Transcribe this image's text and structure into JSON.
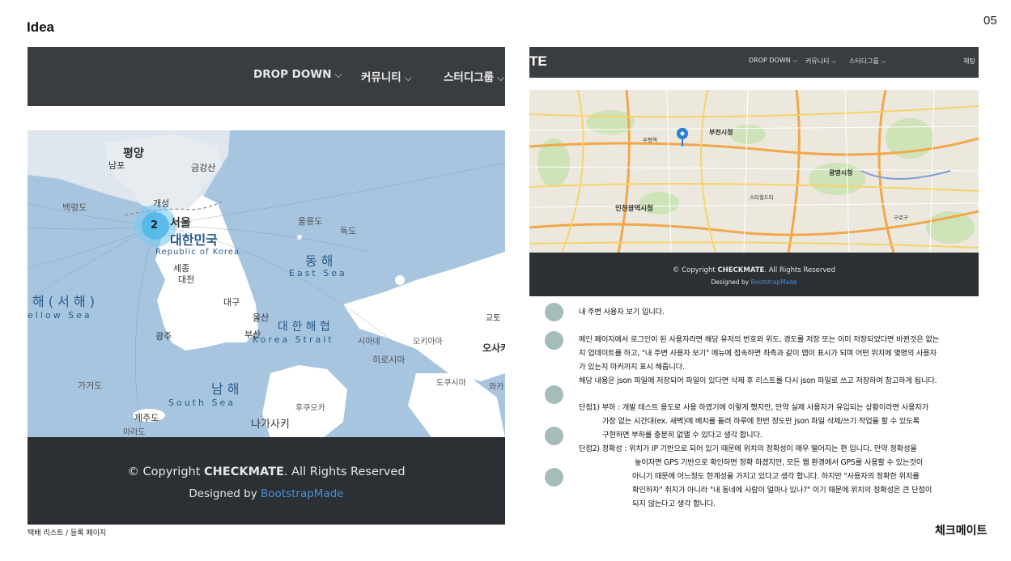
{
  "header": {
    "title": "Idea",
    "page_number": "05"
  },
  "left_mockup": {
    "nav": [
      {
        "label": "DROP DOWN",
        "icon": "chevron-down-icon"
      },
      {
        "label": "커뮤니티",
        "icon": "chevron-down-icon"
      },
      {
        "label": "스터디그룹",
        "icon": "chevron-down-icon"
      }
    ],
    "map": {
      "cluster_count": "2",
      "labels": {
        "pyongyang": "평양",
        "nampo": "남포",
        "geumgangsan": "금강산",
        "baengnyeongdo": "백령도",
        "kaesong": "개성",
        "seoul": "서울",
        "korea_ko": "대한민국",
        "korea_en": "Republic of Korea",
        "ulleungdo": "울릉도",
        "dokdo": "독도",
        "east_sea_ko": "동 해",
        "east_sea_en": "East Sea",
        "sejong": "세종",
        "daejeon": "대전",
        "yellow_sea_ko": "해 ( 서 해 )",
        "yellow_sea_en": "ellow Sea",
        "daegu": "대구",
        "ulsan": "울산",
        "korea_strait_ko": "대 한 해 협",
        "korea_strait_en": "Korea Strait",
        "gwangju": "광주",
        "busan": "부산",
        "shimane": "시마네",
        "okinoshima": "오키아마",
        "hiroshima": "히로시마",
        "osaka": "오사카",
        "kyoto": "교토",
        "gageodo": "가거도",
        "south_sea_ko": "남 해",
        "south_sea_en": "South Sea",
        "tokushima": "도쿠시마",
        "wakayama": "와카",
        "fukuoka": "후쿠오카",
        "jejudo": "제주도",
        "marado": "마라도",
        "nagasaki": "나가사키"
      }
    },
    "footer": {
      "copyright_prefix": "© Copyright ",
      "brand": "CHECKMATE",
      "copyright_suffix": ". All Rights Reserved",
      "designed_prefix": "Designed by ",
      "designed_link": "BootstrapMade"
    },
    "caption": "택배 리스트 / 등록 페이지"
  },
  "right_mockup": {
    "brand_fragment": "TE",
    "nav": [
      {
        "label": "DROP DOWN",
        "icon": "chevron-down-icon"
      },
      {
        "label": "커뮤니티",
        "icon": "chevron-down-icon"
      },
      {
        "label": "스터디그룹",
        "icon": "chevron-down-icon"
      },
      {
        "label": "채팅",
        "icon": ""
      }
    ],
    "map": {
      "labels": {
        "bucheon": "부천시청",
        "gwangmyeong": "광명시청",
        "incheon": "인천광역시청",
        "starcity": "스타힐드티",
        "bupyeong": "부평역",
        "guro": "구로구"
      },
      "marker_icon": "map-pin-icon"
    },
    "footer": {
      "copyright_prefix": "© Copyright ",
      "brand": "CHECKMATE",
      "copyright_suffix": ". All Rights Reserved",
      "designed_prefix": "Designed by ",
      "designed_link": "BootstrapMade"
    }
  },
  "description": {
    "lines": [
      "내 주변 사용자 보기 입니다.",
      "메인 페이지에서 로그인이 된 사용자라면 해당 유저의 번호와 위도, 경도를 저장 또는 이미 저장되었다면 바뀐것은 없는",
      "지 업데이트를 하고, \"내 주변 사용자 보기\" 메뉴에 접속하면 좌측과 같이 맵이 표시가 되며 어떤 위치에 몇명의 사용자",
      "가 있는지 마커까지 표시 해줍니다.",
      "해당 내용은 json 파일에 저장되어 파일이 있다면 삭제 후 리스트를 다시 json 파일로 쓰고 저장하여 참고하게 됩니다.",
      "단점1) 부하 : 개발 테스트 용도로 사용 하였기에 이렇게 했지만, 만약 실제 사용자가 유입되는 상황이라면 사용자가",
      "가장 없는 시간대(ex. 새벽)에 배치를 돌려 하루에 한번 정도만 json 파일 삭제/쓰기 작업을 할 수 있도록",
      "구현하면 부하를 충분히 없앨 수 있다고 생각 합니다.",
      "단점2) 정확성 : 위치가 IP 기반으로 되어 있기 때문에 위치의 정확성이 매우 떨어지는 편 입니다. 만약 정확성을",
      "높이자면 GPS 기반으로 확인하면 정확 하겠지만, 모든 웹 환경에서 GPS를 사용할 수 있는것이",
      "아니기 때문에 어느정도 한계성을 가지고 있다고 생각 합니다. 하지만 \"사용자의 정확한 위치를",
      "확인하자\" 취지가 아니라 \"내 동네에 사람이 얼마나 있나?\" 이기 때문에 위치의 정확성은 큰 단점이",
      "되지 않는다고 생각 합니다."
    ]
  },
  "footer_brand": "체크메이트"
}
